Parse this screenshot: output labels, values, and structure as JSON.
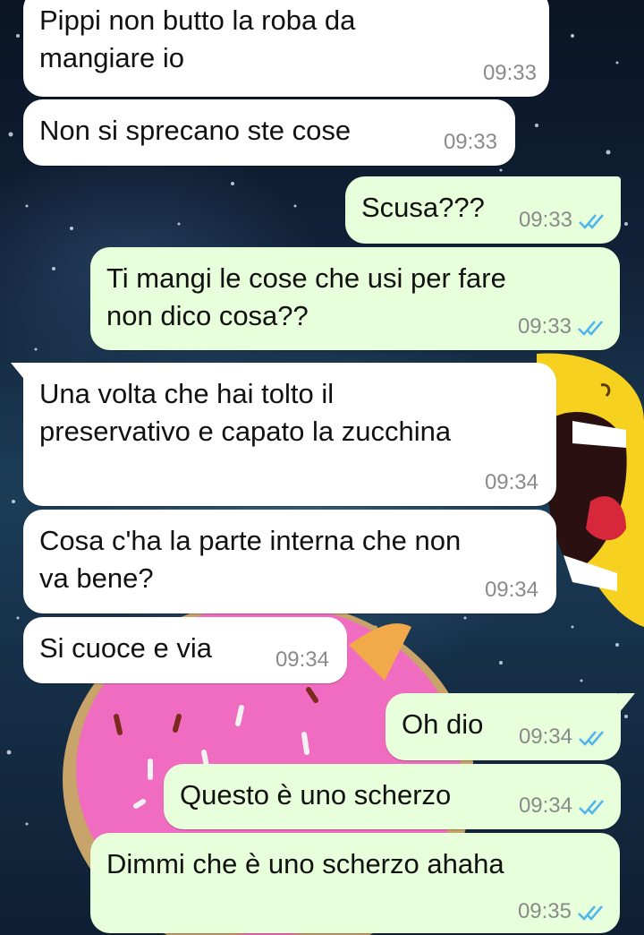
{
  "colors": {
    "incoming_bubble": "#ffffff",
    "outgoing_bubble": "#e7ffdb",
    "timestamp": "#8a8a8a",
    "read_ticks": "#4fb6ec"
  },
  "messages": [
    {
      "direction": "incoming",
      "lines": [
        "Pippi non butto la roba da",
        "mangiare io"
      ],
      "time": "09:33"
    },
    {
      "direction": "incoming",
      "lines": [
        "Non si sprecano ste cose"
      ],
      "time": "09:33"
    },
    {
      "direction": "outgoing",
      "lines": [
        "Scusa???"
      ],
      "time": "09:33",
      "status": "read-ticks-icon"
    },
    {
      "direction": "outgoing",
      "lines": [
        "Ti mangi le cose che usi per fare",
        "non dico cosa??"
      ],
      "time": "09:33",
      "status": "read-ticks-icon"
    },
    {
      "direction": "incoming",
      "lines": [
        "Una volta che hai tolto il",
        "preservativo e capato la zucchina"
      ],
      "time": "09:34"
    },
    {
      "direction": "incoming",
      "lines": [
        "Cosa c'ha la parte interna che non",
        "va bene?"
      ],
      "time": "09:34"
    },
    {
      "direction": "incoming",
      "lines": [
        "Si cuoce e via"
      ],
      "time": "09:34"
    },
    {
      "direction": "outgoing",
      "lines": [
        "Oh dio"
      ],
      "time": "09:34",
      "status": "read-ticks-icon"
    },
    {
      "direction": "outgoing",
      "lines": [
        "Questo è uno scherzo"
      ],
      "time": "09:34",
      "status": "read-ticks-icon"
    },
    {
      "direction": "outgoing",
      "lines": [
        "Dimmi che è uno scherzo ahaha"
      ],
      "time": "09:35",
      "status": "read-ticks-icon"
    }
  ]
}
